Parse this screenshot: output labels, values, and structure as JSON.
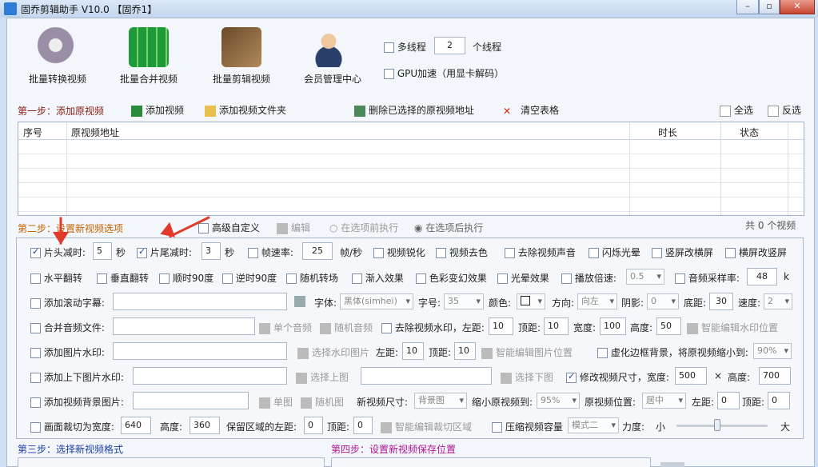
{
  "window": {
    "title": "固乔剪辑助手 V10.0 【固乔1】"
  },
  "toolbar": {
    "tools": [
      "批量转换视频",
      "批量合并视频",
      "批量剪辑视频",
      "会员管理中心"
    ],
    "multithread_label": "多线程",
    "thread_count": "2",
    "thread_unit": "个线程",
    "gpu_label": "GPU加速（用显卡解码）"
  },
  "step1": {
    "title": "第一步：添加原视频",
    "add_video": "添加视频",
    "add_folder": "添加视频文件夹",
    "delete_selected": "删除已选择的原视频地址",
    "clear_table": "清空表格",
    "select_all": "全选",
    "invert_select": "反选"
  },
  "table": {
    "columns": [
      "序号",
      "原视频地址",
      "时长",
      "状态"
    ]
  },
  "step2": {
    "title": "第二步：设置新视频选项",
    "advanced": "高级自定义",
    "edit": "编辑",
    "before": "在选项前执行",
    "after": "在选项后执行",
    "count_text": "共 0 个视频"
  },
  "opts": {
    "head_cut": "片头减时:",
    "head_val": "5",
    "sec1": "秒",
    "tail_cut": "片尾减时:",
    "tail_val": "3",
    "sec2": "秒",
    "fps": "帧速率:",
    "fps_val": "25",
    "fps_unit": "帧/秒",
    "sharpen": "视频锐化",
    "decolor": "视频去色",
    "remove_audio": "去除视频声音",
    "flash": "闪烁光晕",
    "v2h": "竖屏改横屏",
    "h2v": "横屏改竖屏",
    "hflip": "水平翻转",
    "vflip": "垂直翻转",
    "cw90": "顺时90度",
    "ccw90": "逆时90度",
    "rand_trans": "随机转场",
    "fadein": "渐入效果",
    "color_fx": "色彩变幻效果",
    "halo": "光晕效果",
    "speed": "播放倍速:",
    "speed_val": "0.5",
    "audio_rate": "音频采样率:",
    "audio_rate_val": "48",
    "audio_rate_unit": "k",
    "scroll_sub": "添加滚动字幕:",
    "font": "字体:",
    "font_val": "黑体(simhei)",
    "size": "字号:",
    "size_val": "35",
    "color": "颜色:",
    "dir": "方向:",
    "dir_val": "向左",
    "shadow": "阴影:",
    "shadow_val": "0",
    "bottom": "底距:",
    "bottom_val": "30",
    "speed2": "速度:",
    "speed2_val": "2",
    "merge_audio": "合并音频文件:",
    "single_audio": "单个音频",
    "rand_audio": "随机音频",
    "remove_wm": "去除视频水印，左距:",
    "wm_left": "10",
    "top": "顶距:",
    "wm_top": "10",
    "width": "宽度:",
    "wm_width": "100",
    "height": "高度:",
    "wm_height": "50",
    "smart_wm": "智能编辑水印位置",
    "img_wm": "添加图片水印:",
    "choose_wm": "选择水印图片",
    "left": "左距:",
    "img_left": "10",
    "top2": "顶距:",
    "img_top": "10",
    "smart_img": "智能编辑图片位置",
    "blur_bg": "虚化边框背景，将原视频缩小到:",
    "blur_val": "90%",
    "tb_img": "添加上下图片水印:",
    "choose_top": "选择上图",
    "choose_bottom": "选择下图",
    "resize": "修改视频尺寸，宽度:",
    "resize_w": "500",
    "x": "×",
    "height2": "高度:",
    "resize_h": "700",
    "bg_img": "添加视频背景图片:",
    "single_img": "单图",
    "rand_img": "随机图",
    "new_size": "新视频尺寸:",
    "new_size_val": "背景图",
    "shrink": "缩小原视频到:",
    "shrink_val": "95%",
    "pos": "原视频位置:",
    "pos_val": "居中",
    "left2": "左距:",
    "pos_left": "0",
    "top3": "顶距:",
    "pos_top": "0",
    "crop": "画面裁切为宽度:",
    "crop_w": "640",
    "height3": "高度:",
    "crop_h": "360",
    "keep_left": "保留区域的左距:",
    "keep_left_val": "0",
    "top4": "顶距:",
    "keep_top_val": "0",
    "smart_crop": "智能编辑裁切区域",
    "compress": "压缩视频容量",
    "mode": "模式二",
    "strength": "力度:",
    "small": "小",
    "big": "大",
    "strength_level": 0.45
  },
  "step3": {
    "title": "第三步：选择新视频格式"
  },
  "step4": {
    "title": "第四步：设置新视频保存位置"
  },
  "colors": {
    "step1": "#8a1d12",
    "step2": "#c86400",
    "step3": "#1a3fa8",
    "step4": "#b2149a"
  }
}
